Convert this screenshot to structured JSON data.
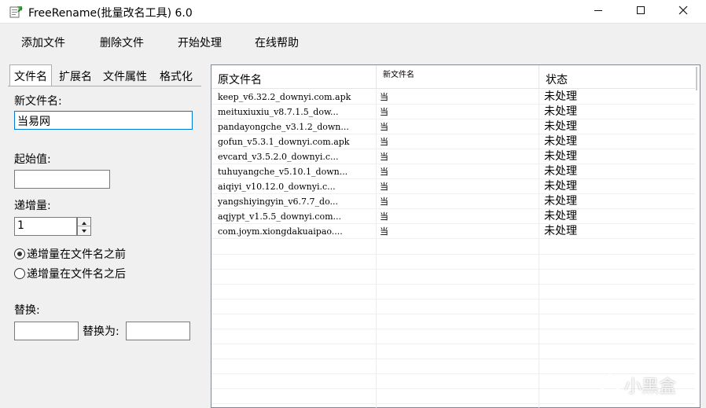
{
  "window": {
    "title": "FreeRename(批量改名工具) 6.0",
    "icon": "app-rename-icon",
    "controls": {
      "minimize": "minimize-icon",
      "maximize": "maximize-icon",
      "close": "close-icon"
    }
  },
  "menu": {
    "items": [
      "添加文件",
      "删除文件",
      "开始处理",
      "在线帮助"
    ]
  },
  "tabs": [
    "文件名",
    "扩展名",
    "文件属性",
    "格式化"
  ],
  "active_tab": "文件名",
  "form": {
    "new_name_label": "新文件名:",
    "new_name_value": "当易网",
    "start_label": "起始值:",
    "start_value": "",
    "increment_label": "递增量:",
    "increment_value": "1",
    "radio_before": "递增量在文件名之前",
    "radio_after": "递增量在文件名之后",
    "radio_selected": "before",
    "replace_label": "替换:",
    "replace_with_label": "替换为:",
    "replace_value": "",
    "replace_with_value": ""
  },
  "list": {
    "columns": [
      "原文件名",
      "新文件名",
      "状态"
    ],
    "rows": [
      {
        "original": "keep_v6.32.2_downyi.com.apk",
        "new": "当",
        "status": "未处理"
      },
      {
        "original": "meituxiuxiu_v8.7.1.5_dow...",
        "new": "当",
        "status": "未处理"
      },
      {
        "original": "pandayongche_v3.1.2_down...",
        "new": "当",
        "status": "未处理"
      },
      {
        "original": "gofun_v5.3.1_downyi.com.apk",
        "new": "当",
        "status": "未处理"
      },
      {
        "original": "evcard_v3.5.2.0_downyi.c...",
        "new": "当",
        "status": "未处理"
      },
      {
        "original": "tuhuyangche_v5.10.1_down...",
        "new": "当",
        "status": "未处理"
      },
      {
        "original": "aiqiyi_v10.12.0_downyi.c...",
        "new": "当",
        "status": "未处理"
      },
      {
        "original": "yangshiyingyin_v6.7.7_do...",
        "new": "当",
        "status": "未处理"
      },
      {
        "original": "aqjypt_v1.5.5_downyi.com...",
        "new": "当",
        "status": "未处理"
      },
      {
        "original": "com.joym.xiongdakuaipao....",
        "new": "当",
        "status": "未处理"
      }
    ]
  },
  "watermark": {
    "text": "小黑盒",
    "icon": "xiaoheihe-logo-icon"
  },
  "colors": {
    "focus_border": "#0078d7",
    "window_bg": "#f0f0f0"
  }
}
